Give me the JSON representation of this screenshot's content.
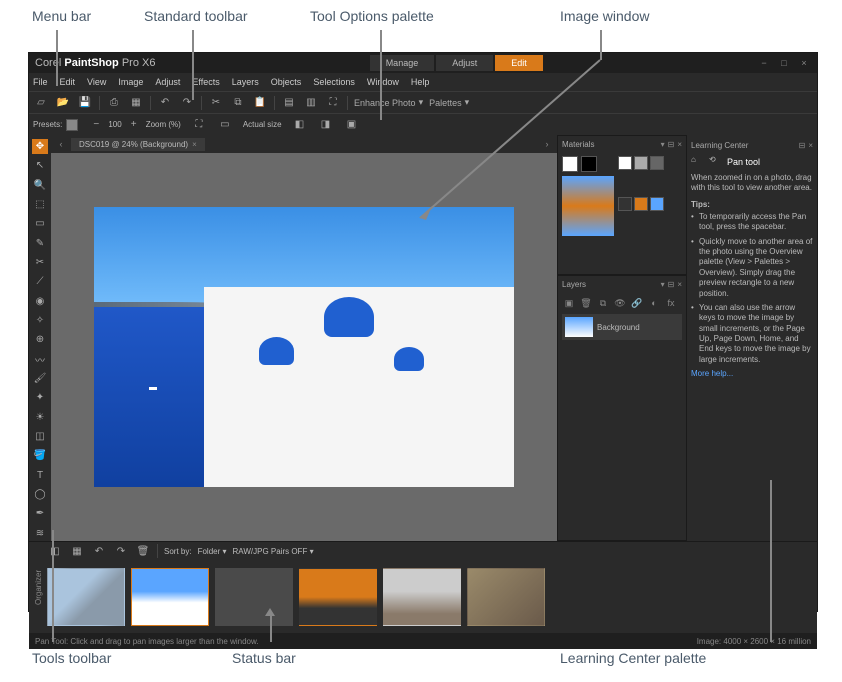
{
  "outer_labels": {
    "menubar": "Menu bar",
    "std_toolbar": "Standard toolbar",
    "tool_options": "Tool Options palette",
    "image_window": "Image window",
    "tools_toolbar": "Tools toolbar",
    "statusbar": "Status bar",
    "learning": "Learning Center palette"
  },
  "app": {
    "title_prefix": "Corel",
    "title_main": "PaintShop",
    "title_suffix": "Pro X6"
  },
  "mode_tabs": {
    "manage": "Manage",
    "adjust": "Adjust",
    "edit": "Edit"
  },
  "menus": [
    "File",
    "Edit",
    "View",
    "Image",
    "Adjust",
    "Effects",
    "Layers",
    "Objects",
    "Selections",
    "Window",
    "Help"
  ],
  "std_toolbar": {
    "enhance_label": "Enhance Photo",
    "palettes_label": "Palettes"
  },
  "tool_options": {
    "presets": "Presets:",
    "zoom": "Zoom (%)",
    "zoom_val": "100",
    "actual": "Actual size"
  },
  "doc_tab": {
    "name": "DSC019 @ 24% (Background)",
    "nav_prev": "‹",
    "nav_next": "›"
  },
  "palettes": {
    "materials": "Materials",
    "layers": "Layers",
    "learning": "Learning Center"
  },
  "layers": {
    "bg_name": "Background"
  },
  "learning": {
    "tool_name": "Pan tool",
    "desc": "When zoomed in on a photo, drag with this tool to view another area.",
    "tips_hdr": "Tips:",
    "tip1": "To temporarily access the Pan tool, press the spacebar.",
    "tip2": "Quickly move to another area of the photo using the Overview palette (View > Palettes > Overview). Simply drag the preview rectangle to a new position.",
    "tip3": "You can also use the arrow keys to move the image by small increments, or the Page Up, Page Down, Home, and End keys to move the image by large increments.",
    "link": "More help..."
  },
  "organizer": {
    "label": "Organizer",
    "sortby": "Sort by:",
    "folder": "Folder",
    "rawjpg": "RAW/JPG Pairs OFF"
  },
  "statusbar": {
    "left": "Pan Tool: Click and drag to pan images larger than the window.",
    "right": "Image: 4000 × 2600 × 16 million"
  }
}
